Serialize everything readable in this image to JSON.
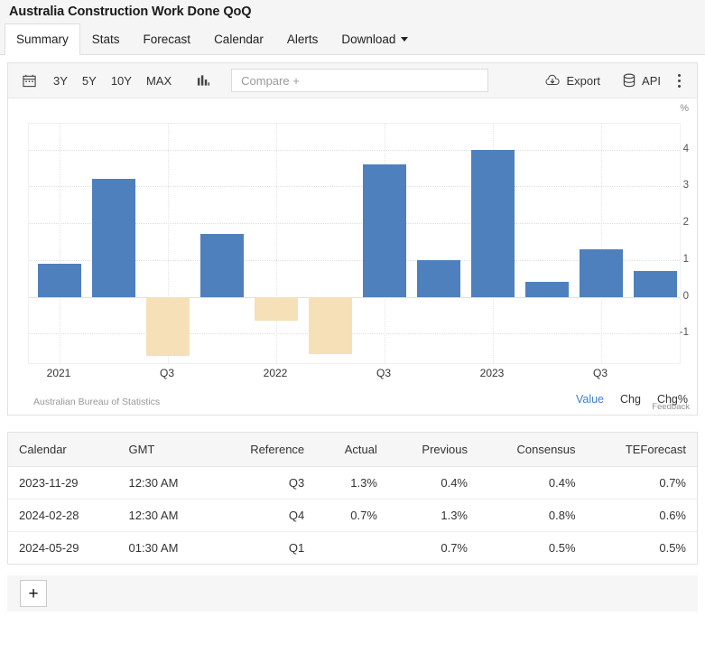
{
  "header": {
    "title": "Australia Construction Work Done QoQ"
  },
  "tabs": [
    {
      "label": "Summary",
      "active": true
    },
    {
      "label": "Stats",
      "active": false
    },
    {
      "label": "Forecast",
      "active": false
    },
    {
      "label": "Calendar",
      "active": false
    },
    {
      "label": "Alerts",
      "active": false
    },
    {
      "label": "Download",
      "active": false,
      "caret": true
    }
  ],
  "toolbar": {
    "calendar_icon": "calendar-icon",
    "ranges": [
      "3Y",
      "5Y",
      "10Y",
      "MAX"
    ],
    "charttype_icon": "bar-chart-icon",
    "compare_placeholder": "Compare +",
    "export_label": "Export",
    "export_icon": "cloud-download-icon",
    "api_label": "API",
    "api_icon": "database-icon",
    "more_icon": "kebab-menu-icon"
  },
  "chart": {
    "unit": "%",
    "source": "Australian Bureau of Statistics",
    "modes": [
      {
        "label": "Value",
        "selected": true
      },
      {
        "label": "Chg",
        "selected": false
      },
      {
        "label": "Chg%",
        "selected": false
      }
    ],
    "feedback": "Feedback",
    "colors": {
      "positive": "#4e80bd",
      "negative": "#f5e0b7",
      "accent": "#3f7fd0"
    }
  },
  "chart_data": {
    "type": "bar",
    "title": "Australia Construction Work Done QoQ",
    "xlabel": "",
    "ylabel": "%",
    "ylim": [
      -1.85,
      4.7
    ],
    "yticks": [
      -1,
      0,
      1,
      2,
      3,
      4
    ],
    "grid": true,
    "legend": false,
    "categories": [
      "2021 Q1",
      "2021 Q2",
      "2021 Q3",
      "2021 Q4",
      "2022 Q1",
      "2022 Q2",
      "2022 Q3",
      "2022 Q4",
      "2023 Q1",
      "2023 Q2",
      "2023 Q3",
      "2023 Q4"
    ],
    "tick_labels": [
      "2021",
      "Q3",
      "2022",
      "Q3",
      "2023",
      "Q3"
    ],
    "tick_indices": [
      0,
      2,
      4,
      6,
      8,
      10
    ],
    "values": [
      0.9,
      3.2,
      -1.6,
      1.7,
      -0.65,
      -1.55,
      3.6,
      1.0,
      4.0,
      0.4,
      1.3,
      0.7
    ]
  },
  "table": {
    "columns": [
      {
        "label": "Calendar",
        "align": "left"
      },
      {
        "label": "GMT",
        "align": "left"
      },
      {
        "label": "Reference",
        "align": "right"
      },
      {
        "label": "Actual",
        "align": "right"
      },
      {
        "label": "Previous",
        "align": "right"
      },
      {
        "label": "Consensus",
        "align": "right"
      },
      {
        "label": "TEForecast",
        "align": "right"
      }
    ],
    "rows": [
      [
        "2023-11-29",
        "12:30 AM",
        "Q3",
        "1.3%",
        "0.4%",
        "0.4%",
        "0.7%"
      ],
      [
        "2024-02-28",
        "12:30 AM",
        "Q4",
        "0.7%",
        "1.3%",
        "0.8%",
        "0.6%"
      ],
      [
        "2024-05-29",
        "01:30 AM",
        "Q1",
        "",
        "0.7%",
        "0.5%",
        "0.5%"
      ]
    ]
  },
  "footer": {
    "add_label": "+"
  }
}
